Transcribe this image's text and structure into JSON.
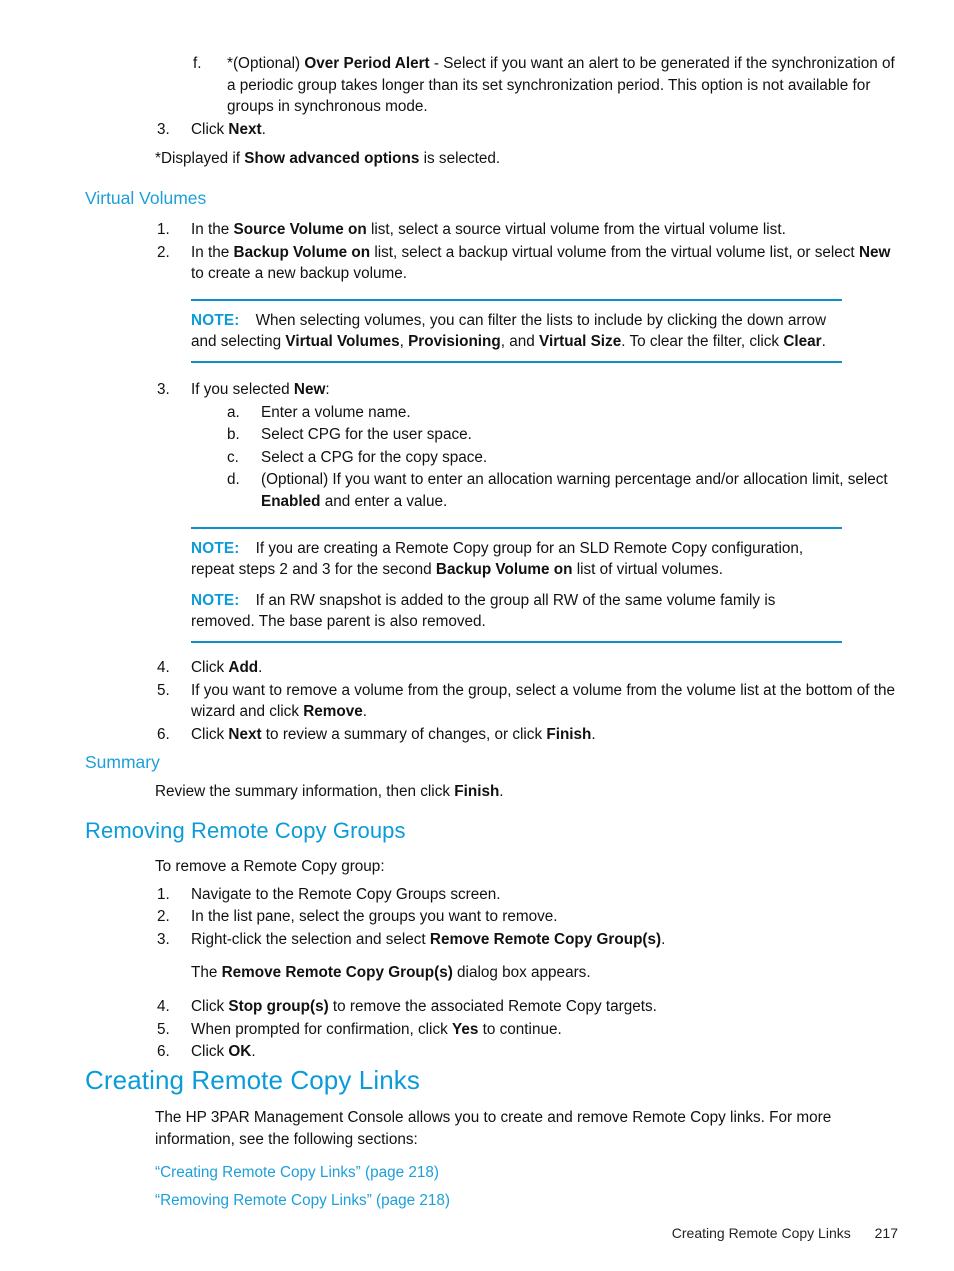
{
  "colors": {
    "heading_blue": "#0b9bd8",
    "link_blue": "#1d9fd9",
    "note_rule": "#0e8fc6",
    "body_text": "#111111"
  },
  "top_section": {
    "sub_item_f": {
      "marker": "f.",
      "prefix": "*(Optional) ",
      "bold_term": "Over Period Alert",
      "rest": " - Select if you want an alert to be generated if the synchronization of a periodic group takes longer than its set synchronization period. This option is not available for groups in synchronous mode."
    },
    "step_3": {
      "marker": "3.",
      "prefix": "Click ",
      "bold_term": "Next",
      "rest": "."
    },
    "footnote": {
      "prefix": "*Displayed if ",
      "bold_term": "Show advanced options",
      "rest": " is selected."
    }
  },
  "virtual_volumes": {
    "heading": "Virtual Volumes",
    "steps": [
      {
        "marker": "1.",
        "parts": [
          {
            "text": "In the ",
            "bold": false
          },
          {
            "text": "Source Volume on",
            "bold": true
          },
          {
            "text": " list, select a source virtual volume from the virtual volume list.",
            "bold": false
          }
        ]
      },
      {
        "marker": "2.",
        "parts": [
          {
            "text": "In the ",
            "bold": false
          },
          {
            "text": "Backup Volume on",
            "bold": true
          },
          {
            "text": " list, select a backup virtual volume from the virtual volume list, or select ",
            "bold": false
          },
          {
            "text": "New",
            "bold": true
          },
          {
            "text": " to create a new backup volume.",
            "bold": false
          }
        ]
      }
    ],
    "note_1": {
      "label": "NOTE:",
      "parts": [
        {
          "text": "When selecting volumes, you can filter the lists to include by clicking the down arrow and selecting ",
          "bold": false
        },
        {
          "text": "Virtual Volumes",
          "bold": true
        },
        {
          "text": ", ",
          "bold": false
        },
        {
          "text": "Provisioning",
          "bold": true
        },
        {
          "text": ", and ",
          "bold": false
        },
        {
          "text": "Virtual Size",
          "bold": true
        },
        {
          "text": ". To clear the filter, click ",
          "bold": false
        },
        {
          "text": "Clear",
          "bold": true
        },
        {
          "text": ".",
          "bold": false
        }
      ]
    },
    "step_3": {
      "marker": "3.",
      "parts": [
        {
          "text": "If you selected ",
          "bold": false
        },
        {
          "text": "New",
          "bold": true
        },
        {
          "text": ":",
          "bold": false
        }
      ],
      "substeps": [
        {
          "marker": "a.",
          "parts": [
            {
              "text": "Enter a volume name.",
              "bold": false
            }
          ]
        },
        {
          "marker": "b.",
          "parts": [
            {
              "text": "Select CPG for the user space.",
              "bold": false
            }
          ]
        },
        {
          "marker": "c.",
          "parts": [
            {
              "text": "Select a CPG for the copy space.",
              "bold": false
            }
          ]
        },
        {
          "marker": "d.",
          "parts": [
            {
              "text": "(Optional) If you want to enter an allocation warning percentage and/or allocation limit, select ",
              "bold": false
            },
            {
              "text": "Enabled",
              "bold": true
            },
            {
              "text": " and enter a value.",
              "bold": false
            }
          ]
        }
      ]
    },
    "note_2": {
      "label": "NOTE:",
      "parts": [
        {
          "text": "If you are creating a Remote Copy group for an SLD Remote Copy configuration, repeat steps 2 and 3 for the second ",
          "bold": false
        },
        {
          "text": "Backup Volume on",
          "bold": true
        },
        {
          "text": " list of virtual volumes.",
          "bold": false
        }
      ]
    },
    "note_3": {
      "label": "NOTE:",
      "parts": [
        {
          "text": "If an RW snapshot is added to the group all RW of the same volume family is removed. The base parent is also removed.",
          "bold": false
        }
      ]
    },
    "steps_after": [
      {
        "marker": "4.",
        "parts": [
          {
            "text": "Click ",
            "bold": false
          },
          {
            "text": "Add",
            "bold": true
          },
          {
            "text": ".",
            "bold": false
          }
        ]
      },
      {
        "marker": "5.",
        "parts": [
          {
            "text": "If you want to remove a volume from the group, select a volume from the volume list at the bottom of the wizard and click ",
            "bold": false
          },
          {
            "text": "Remove",
            "bold": true
          },
          {
            "text": ".",
            "bold": false
          }
        ]
      },
      {
        "marker": "6.",
        "parts": [
          {
            "text": "Click ",
            "bold": false
          },
          {
            "text": "Next",
            "bold": true
          },
          {
            "text": " to review a summary of changes, or click ",
            "bold": false
          },
          {
            "text": "Finish",
            "bold": true
          },
          {
            "text": ".",
            "bold": false
          }
        ]
      }
    ]
  },
  "summary": {
    "heading": "Summary",
    "paragraph_parts": [
      {
        "text": "Review the summary information, then click ",
        "bold": false
      },
      {
        "text": "Finish",
        "bold": true
      },
      {
        "text": ".",
        "bold": false
      }
    ]
  },
  "removing_groups": {
    "heading": "Removing Remote Copy Groups",
    "intro": "To remove a Remote Copy group:",
    "steps": [
      {
        "marker": "1.",
        "parts": [
          {
            "text": "Navigate to the Remote Copy Groups screen.",
            "bold": false
          }
        ]
      },
      {
        "marker": "2.",
        "parts": [
          {
            "text": "In the list pane, select the groups you want to remove.",
            "bold": false
          }
        ]
      },
      {
        "marker": "3.",
        "parts": [
          {
            "text": "Right-click the selection and select ",
            "bold": false
          },
          {
            "text": "Remove Remote Copy Group(s)",
            "bold": true
          },
          {
            "text": ".",
            "bold": false
          }
        ]
      }
    ],
    "dialog_note_parts": [
      {
        "text": "The ",
        "bold": false
      },
      {
        "text": "Remove Remote Copy Group(s)",
        "bold": true
      },
      {
        "text": " dialog box appears.",
        "bold": false
      }
    ],
    "steps_after": [
      {
        "marker": "4.",
        "parts": [
          {
            "text": "Click ",
            "bold": false
          },
          {
            "text": "Stop group(s)",
            "bold": true
          },
          {
            "text": " to remove the associated Remote Copy targets.",
            "bold": false
          }
        ]
      },
      {
        "marker": "5.",
        "parts": [
          {
            "text": "When prompted for confirmation, click ",
            "bold": false
          },
          {
            "text": "Yes",
            "bold": true
          },
          {
            "text": " to continue.",
            "bold": false
          }
        ]
      },
      {
        "marker": "6.",
        "parts": [
          {
            "text": "Click ",
            "bold": false
          },
          {
            "text": "OK",
            "bold": true
          },
          {
            "text": ".",
            "bold": false
          }
        ]
      }
    ]
  },
  "creating_links": {
    "heading": "Creating Remote Copy Links",
    "paragraph": "The HP 3PAR Management Console allows you to create and remove Remote Copy links. For more information, see the following sections:",
    "links": [
      "“Creating Remote Copy Links” (page 218)",
      "“Removing Remote Copy Links” (page 218)"
    ]
  },
  "footer": {
    "section_title": "Creating Remote Copy Links",
    "page_number": "217"
  }
}
